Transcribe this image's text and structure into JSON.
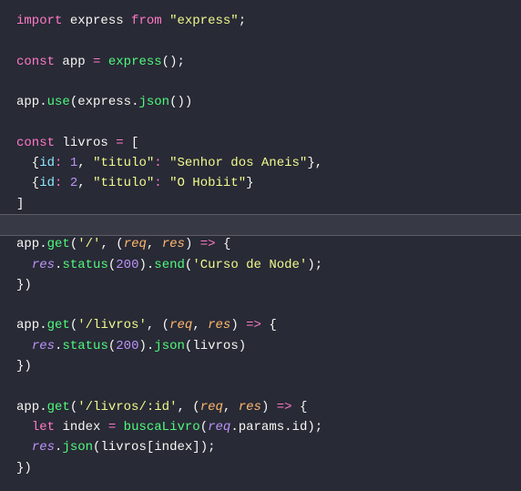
{
  "code": {
    "lines": [
      [
        [
          "kw",
          "import"
        ],
        [
          "pun",
          " "
        ],
        [
          "var",
          "express"
        ],
        [
          "pun",
          " "
        ],
        [
          "kw",
          "from"
        ],
        [
          "pun",
          " "
        ],
        [
          "str",
          "\"express\""
        ],
        [
          "pun",
          ";"
        ]
      ],
      [],
      [
        [
          "kw",
          "const"
        ],
        [
          "pun",
          " "
        ],
        [
          "var",
          "app"
        ],
        [
          "pun",
          " "
        ],
        [
          "op",
          "="
        ],
        [
          "pun",
          " "
        ],
        [
          "fn",
          "express"
        ],
        [
          "pun",
          "();"
        ]
      ],
      [],
      [
        [
          "var",
          "app"
        ],
        [
          "pun",
          "."
        ],
        [
          "fn",
          "use"
        ],
        [
          "pun",
          "("
        ],
        [
          "var",
          "express"
        ],
        [
          "pun",
          "."
        ],
        [
          "fn",
          "json"
        ],
        [
          "pun",
          "())"
        ]
      ],
      [],
      [
        [
          "kw",
          "const"
        ],
        [
          "pun",
          " "
        ],
        [
          "var",
          "livros"
        ],
        [
          "pun",
          " "
        ],
        [
          "op",
          "="
        ],
        [
          "pun",
          " ["
        ]
      ],
      [
        [
          "pun",
          "  {"
        ],
        [
          "prop",
          "id"
        ],
        [
          "op",
          ":"
        ],
        [
          "pun",
          " "
        ],
        [
          "num",
          "1"
        ],
        [
          "pun",
          ", "
        ],
        [
          "str",
          "\"titulo\""
        ],
        [
          "op",
          ":"
        ],
        [
          "pun",
          " "
        ],
        [
          "str",
          "\"Senhor dos Aneis\""
        ],
        [
          "pun",
          "},"
        ]
      ],
      [
        [
          "pun",
          "  {"
        ],
        [
          "prop",
          "id"
        ],
        [
          "op",
          ":"
        ],
        [
          "pun",
          " "
        ],
        [
          "num",
          "2"
        ],
        [
          "pun",
          ", "
        ],
        [
          "str",
          "\"titulo\""
        ],
        [
          "op",
          ":"
        ],
        [
          "pun",
          " "
        ],
        [
          "str",
          "\"O Hobiit\""
        ],
        [
          "pun",
          "}"
        ]
      ],
      [
        [
          "pun",
          "]"
        ]
      ],
      [],
      [
        [
          "var",
          "app"
        ],
        [
          "pun",
          "."
        ],
        [
          "fn",
          "get"
        ],
        [
          "pun",
          "("
        ],
        [
          "str",
          "'/'"
        ],
        [
          "pun",
          ", ("
        ],
        [
          "param",
          "req"
        ],
        [
          "pun",
          ", "
        ],
        [
          "param",
          "res"
        ],
        [
          "pun",
          ") "
        ],
        [
          "kw",
          "=>"
        ],
        [
          "pun",
          " {"
        ]
      ],
      [
        [
          "pun",
          "  "
        ],
        [
          "paramobj",
          "res"
        ],
        [
          "pun",
          "."
        ],
        [
          "fn",
          "status"
        ],
        [
          "pun",
          "("
        ],
        [
          "num",
          "200"
        ],
        [
          "pun",
          ")."
        ],
        [
          "fn",
          "send"
        ],
        [
          "pun",
          "("
        ],
        [
          "str",
          "'Curso de Node'"
        ],
        [
          "pun",
          ");"
        ]
      ],
      [
        [
          "pun",
          "})"
        ]
      ],
      [],
      [
        [
          "var",
          "app"
        ],
        [
          "pun",
          "."
        ],
        [
          "fn",
          "get"
        ],
        [
          "pun",
          "("
        ],
        [
          "str",
          "'/livros'"
        ],
        [
          "pun",
          ", ("
        ],
        [
          "param",
          "req"
        ],
        [
          "pun",
          ", "
        ],
        [
          "param",
          "res"
        ],
        [
          "pun",
          ") "
        ],
        [
          "kw",
          "=>"
        ],
        [
          "pun",
          " {"
        ]
      ],
      [
        [
          "pun",
          "  "
        ],
        [
          "paramobj",
          "res"
        ],
        [
          "pun",
          "."
        ],
        [
          "fn",
          "status"
        ],
        [
          "pun",
          "("
        ],
        [
          "num",
          "200"
        ],
        [
          "pun",
          ")."
        ],
        [
          "fn",
          "json"
        ],
        [
          "pun",
          "("
        ],
        [
          "var",
          "livros"
        ],
        [
          "pun",
          ")"
        ]
      ],
      [
        [
          "pun",
          "})"
        ]
      ],
      [],
      [
        [
          "var",
          "app"
        ],
        [
          "pun",
          "."
        ],
        [
          "fn",
          "get"
        ],
        [
          "pun",
          "("
        ],
        [
          "str",
          "'/livros/:id'"
        ],
        [
          "pun",
          ", ("
        ],
        [
          "param",
          "req"
        ],
        [
          "pun",
          ", "
        ],
        [
          "param",
          "res"
        ],
        [
          "pun",
          ") "
        ],
        [
          "kw",
          "=>"
        ],
        [
          "pun",
          " {"
        ]
      ],
      [
        [
          "pun",
          "  "
        ],
        [
          "kw",
          "let"
        ],
        [
          "pun",
          " "
        ],
        [
          "var",
          "index"
        ],
        [
          "pun",
          " "
        ],
        [
          "op",
          "="
        ],
        [
          "pun",
          " "
        ],
        [
          "fn",
          "buscaLivro"
        ],
        [
          "pun",
          "("
        ],
        [
          "paramobj",
          "req"
        ],
        [
          "pun",
          "."
        ],
        [
          "var",
          "params"
        ],
        [
          "pun",
          "."
        ],
        [
          "var",
          "id"
        ],
        [
          "pun",
          ");"
        ]
      ],
      [
        [
          "pun",
          "  "
        ],
        [
          "paramobj",
          "res"
        ],
        [
          "pun",
          "."
        ],
        [
          "fn",
          "json"
        ],
        [
          "pun",
          "("
        ],
        [
          "var",
          "livros"
        ],
        [
          "pun",
          "["
        ],
        [
          "var",
          "index"
        ],
        [
          "pun",
          "]);"
        ]
      ],
      [
        [
          "pun",
          "})"
        ]
      ]
    ],
    "active_line_index": 10
  }
}
